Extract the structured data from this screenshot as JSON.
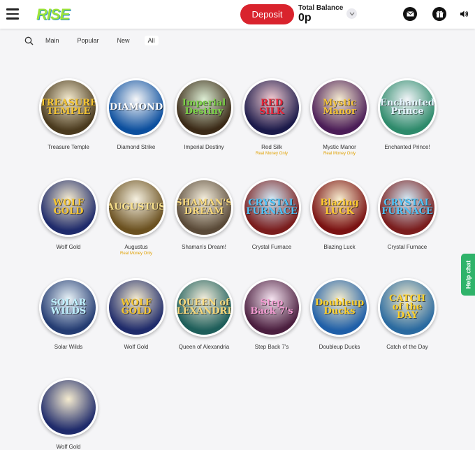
{
  "brand": {
    "logo_text": "RISE"
  },
  "header": {
    "deposit_label": "Deposit",
    "balance_label": "Total Balance",
    "balance_value": "0p"
  },
  "filters": [
    "Main",
    "Popular",
    "New",
    "All"
  ],
  "active_filter": "All",
  "games": [
    {
      "name": "Treasure Temple",
      "art": "TREASURE TEMPLE",
      "note": "",
      "bg": "#4a3a1e",
      "fg": "#f5c531"
    },
    {
      "name": "Diamond Strike",
      "art": "DIAMOND",
      "note": "",
      "bg": "#0c4f9e",
      "fg": "#ffffff"
    },
    {
      "name": "Imperial Destiny",
      "art": "Imperial Destiny",
      "note": "",
      "bg": "#3b2a17",
      "fg": "#7ad146"
    },
    {
      "name": "Red Silk",
      "art": "RED SILK",
      "note": "Real Money Only",
      "bg": "#1b1a4a",
      "fg": "#e8263a"
    },
    {
      "name": "Mystic Manor",
      "art": "Mystic Manor",
      "note": "Real Money Only",
      "bg": "#4b1d57",
      "fg": "#f3c237"
    },
    {
      "name": "Enchanted Prince!",
      "art": "Enchanted Prince",
      "note": "",
      "bg": "#2e8a6b",
      "fg": "#e6f4ff"
    },
    {
      "name": "Wolf Gold",
      "art": "WOLF GOLD",
      "note": "",
      "bg": "#1f2b6b",
      "fg": "#f5c531"
    },
    {
      "name": "Augustus",
      "art": "AUGUSTUS",
      "note": "Real Money Only",
      "bg": "#6b5120",
      "fg": "#f8e08a"
    },
    {
      "name": "Shaman's Dream!",
      "art": "SHAMAN'S DREAM",
      "note": "",
      "bg": "#5a4a38",
      "fg": "#f6d77a"
    },
    {
      "name": "Crystal Furnace",
      "art": "CRYSTAL FURNACE",
      "note": "",
      "bg": "#7a1d1d",
      "fg": "#4fc3f7"
    },
    {
      "name": "Blazing Luck",
      "art": "Blazing LUCK",
      "note": "",
      "bg": "#7a1212",
      "fg": "#ffcc2e"
    },
    {
      "name": "Crystal Furnace",
      "art": "CRYSTAL FURNACE",
      "note": "",
      "bg": "#7a1d1d",
      "fg": "#4fc3f7"
    },
    {
      "name": "Solar Wilds",
      "art": "SOLAR WILDS",
      "note": "",
      "bg": "#243c72",
      "fg": "#bff1ff"
    },
    {
      "name": "Wolf Gold",
      "art": "WOLF GOLD",
      "note": "",
      "bg": "#1f2b6b",
      "fg": "#f5c531"
    },
    {
      "name": "Queen of Alexandria",
      "art": "QUEEN of ALEXANDRIA",
      "note": "",
      "bg": "#1e5e5a",
      "fg": "#f6d77a"
    },
    {
      "name": "Step Back 7's",
      "art": "Step Back 7's",
      "note": "",
      "bg": "#4b1f3f",
      "fg": "#f39ad1"
    },
    {
      "name": "Doubleup Ducks",
      "art": "Doubleup Ducks",
      "note": "",
      "bg": "#1f5fa8",
      "fg": "#ffd02a"
    },
    {
      "name": "Catch of the Day",
      "art": "CATCH of the DAY",
      "note": "",
      "bg": "#2a6aa0",
      "fg": "#ffd02a"
    },
    {
      "name": "Wolf Gold",
      "art": "",
      "note": "",
      "bg": "#1f2b6b",
      "fg": "#f5c531"
    }
  ],
  "help_chat_label": "Help chat",
  "icons": {
    "menu": "hamburger-menu-icon",
    "mail": "mail-icon",
    "gift": "gift-icon",
    "sound": "speaker-icon",
    "search": "search-icon",
    "chevron": "chevron-down-icon"
  },
  "colors": {
    "deposit": "#d9232d",
    "page_bg": "#f5f5f7",
    "help_chat": "#2fb36a",
    "note": "#e0a100"
  }
}
